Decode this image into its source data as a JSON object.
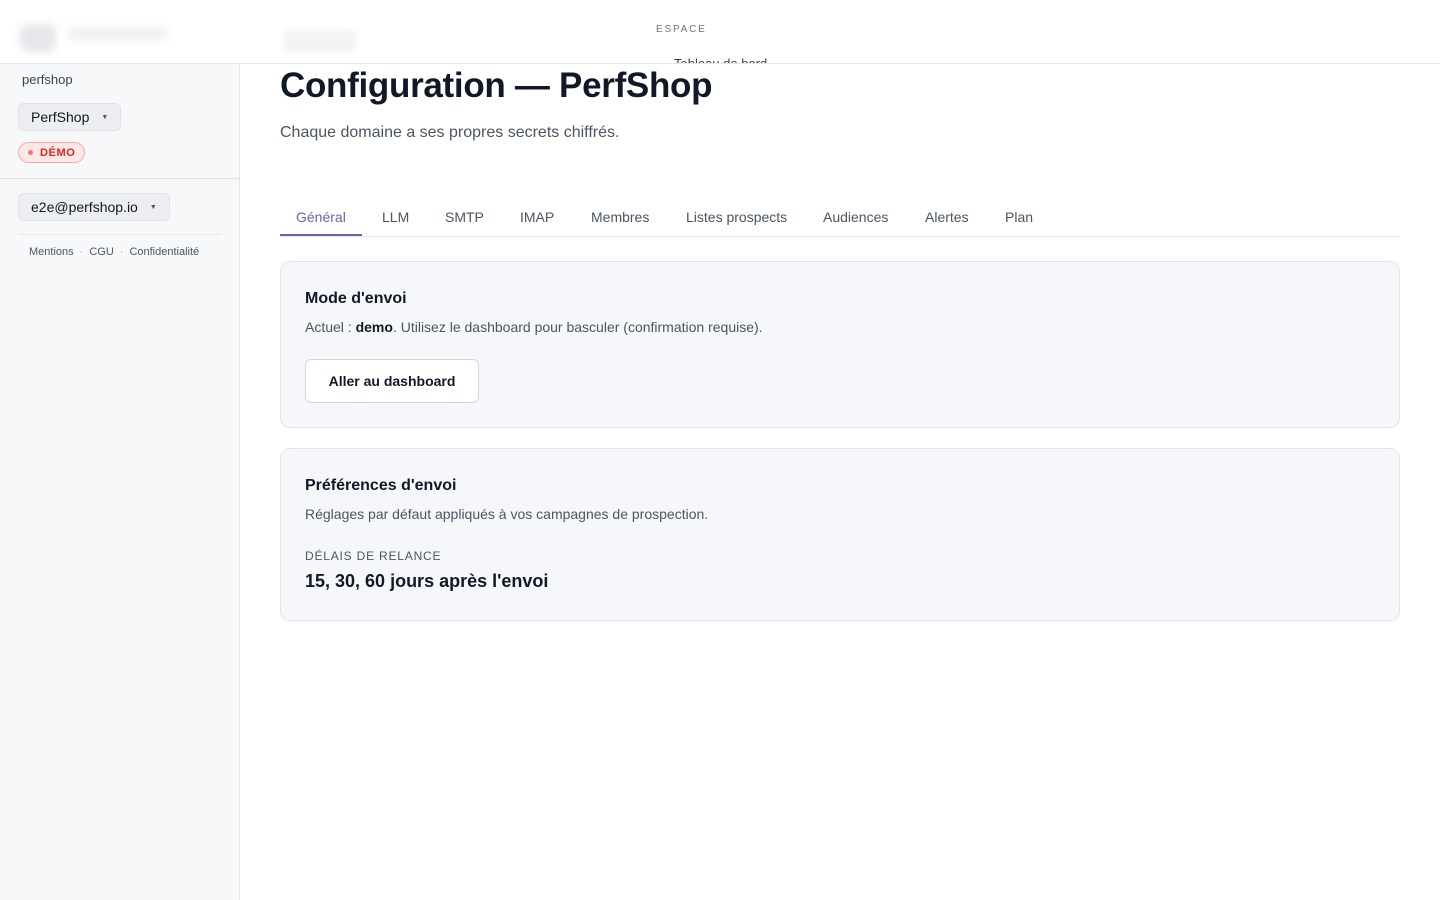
{
  "topbar": {
    "space_label": "ESPACE",
    "space_sub": "Tableau de bord"
  },
  "sidebar": {
    "workspace_slug": "perfshop",
    "domain_select": "PerfShop",
    "mode_badge": "DÉMO",
    "user_select": "e2e@perfshop.io",
    "legal": [
      "Mentions",
      "CGU",
      "Confidentialité"
    ],
    "legal_separator": "·"
  },
  "main": {
    "title": "Configuration — PerfShop",
    "subtitle": "Chaque domaine a ses propres secrets chiffrés.",
    "tabs": [
      {
        "label": "Général",
        "active": true
      },
      {
        "label": "LLM"
      },
      {
        "label": "SMTP"
      },
      {
        "label": "IMAP"
      },
      {
        "label": "Membres"
      },
      {
        "label": "Listes prospects"
      },
      {
        "label": "Audiences"
      },
      {
        "label": "Alertes"
      },
      {
        "label": "Plan"
      }
    ],
    "send_mode_card": {
      "title": "Mode d'envoi",
      "text_prefix": "Actuel : ",
      "current_mode": "demo",
      "text_suffix": ". Utilisez le dashboard pour basculer (confirmation requise).",
      "button_label": "Aller au dashboard"
    },
    "preferences_card": {
      "title": "Préférences d'envoi",
      "description": "Réglages par défaut appliqués à vos campagnes de prospection.",
      "delays_label": "DÉLAIS DE RELANCE",
      "delays_value": "15, 30, 60 jours après l'envoi"
    }
  },
  "colors": {
    "accent": "#6366a8",
    "demo_badge": "#dc2626",
    "card_bg": "#f6f7fa"
  }
}
